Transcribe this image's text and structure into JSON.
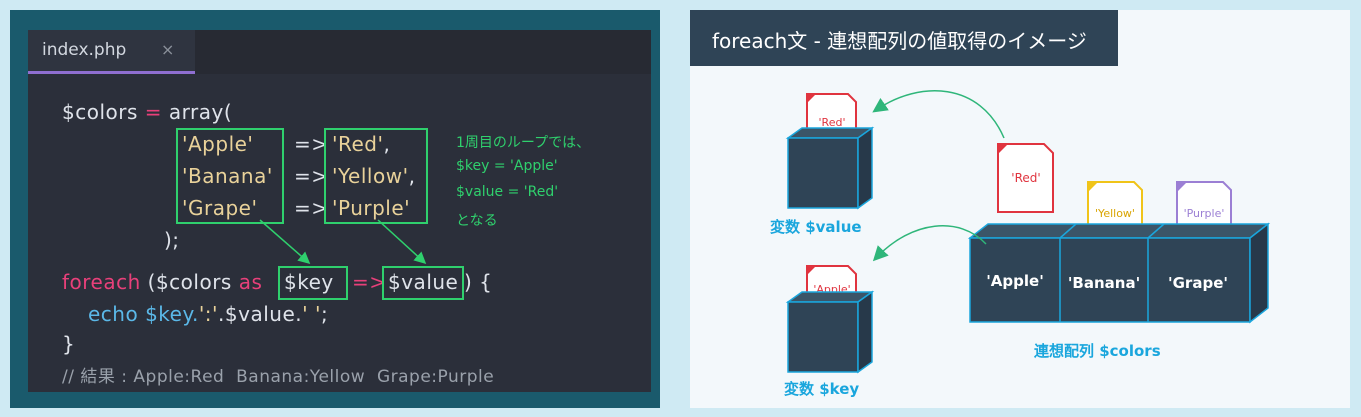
{
  "editor": {
    "tab_title": "index.php",
    "close_glyph": "×",
    "lines": {
      "colors_var": "$colors",
      "eq": " = ",
      "array_open": "array(",
      "keys": [
        "'Apple'",
        "'Banana'",
        "'Grape'"
      ],
      "arrow": "=>",
      "values": [
        "'Red'",
        "'Yellow'",
        "'Purple'"
      ],
      "comma": ",",
      "close": ");",
      "foreach_kw": "foreach",
      "foreach_open": " ($colors ",
      "as_kw": "as",
      "key_var": "$key",
      "double_arrow": "=>",
      "value_var": "$value",
      "foreach_close": ") {",
      "echo_line_a": "echo $key.",
      "echo_sep": "':'",
      "echo_line_b": ".$value.",
      "echo_space": "' '",
      "echo_end": ";",
      "brace_close": "}",
      "result_comment": "// 結果 : Apple:Red  Banana:Yellow  Grape:Purple"
    },
    "note_lines": [
      "1周目のループでは、",
      "$key = 'Apple'",
      "$value = 'Red'",
      "となる"
    ],
    "colors": {
      "green": "#2fd06d",
      "keyword": "#e8407a",
      "string": "#e9d29a",
      "tab_underline": "#8f6fd1"
    }
  },
  "diagram": {
    "title": "foreach文 - 連想配列の値取得のイメージ",
    "value_box_label": "変数 $value",
    "key_box_label": "変数 $key",
    "array_label": "連想配列 $colors",
    "array_keys": [
      "'Apple'",
      "'Banana'",
      "'Grape'"
    ],
    "card_in_value": "'Red'",
    "card_in_key": "'Apple'",
    "floating_card": "'Red'",
    "array_cards": [
      "'Yellow'",
      "'Purple'"
    ],
    "colors": {
      "box": "#2f4456",
      "label": "#1aa6dd",
      "arrow": "#2fb67a",
      "red": "#e0343f",
      "yellow": "#f0c419",
      "purple": "#9b7fd4"
    }
  }
}
